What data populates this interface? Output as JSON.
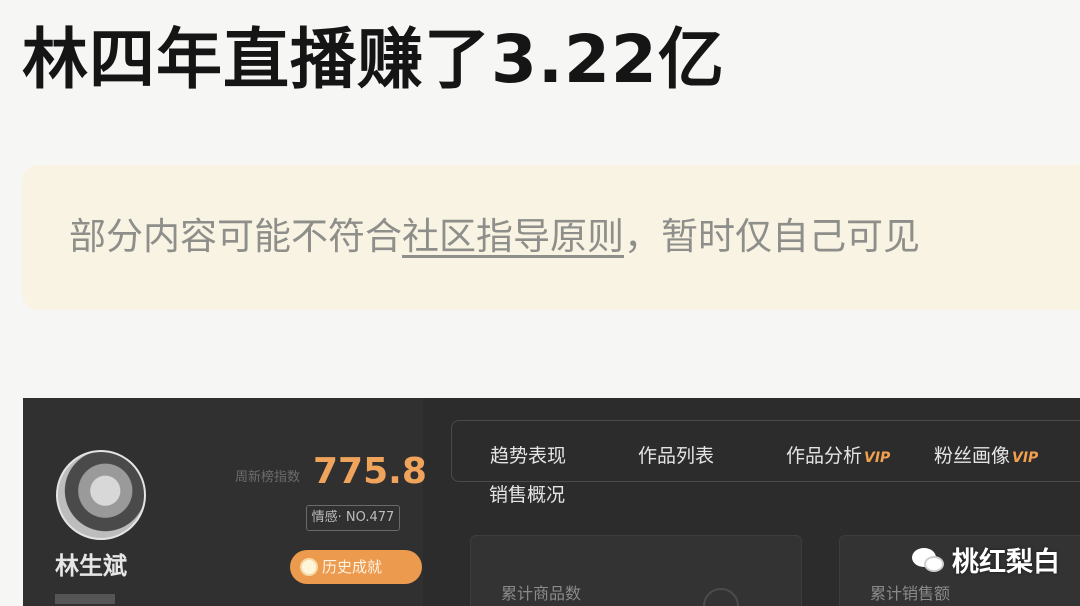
{
  "headline": "林四年直播赚了3.22亿",
  "notice": {
    "prefix": "部分内容可能不符合",
    "link": "社区指导原则",
    "suffix": "，暂时仅自己可见"
  },
  "dashboard": {
    "profile": {
      "name": "林生斌",
      "index_label": "周新榜指数",
      "index_value": "775.8",
      "rank_badge": "情感· NO.477",
      "history_button": "历史成就"
    },
    "tabs": [
      {
        "label": "趋势表现",
        "vip": ""
      },
      {
        "label": "作品列表",
        "vip": ""
      },
      {
        "label": "作品分析",
        "vip": "VIP"
      },
      {
        "label": "粉丝画像",
        "vip": "VIP"
      }
    ],
    "sales_tab": "销售概况",
    "cards": [
      {
        "label": "累计商品数"
      },
      {
        "label": "累计销售额"
      }
    ]
  },
  "watermark": "桃红梨白",
  "colors": {
    "accent_orange": "#f0a35a",
    "notice_bg": "#f8f3e2",
    "dashboard_bg": "#2c2c2c"
  }
}
